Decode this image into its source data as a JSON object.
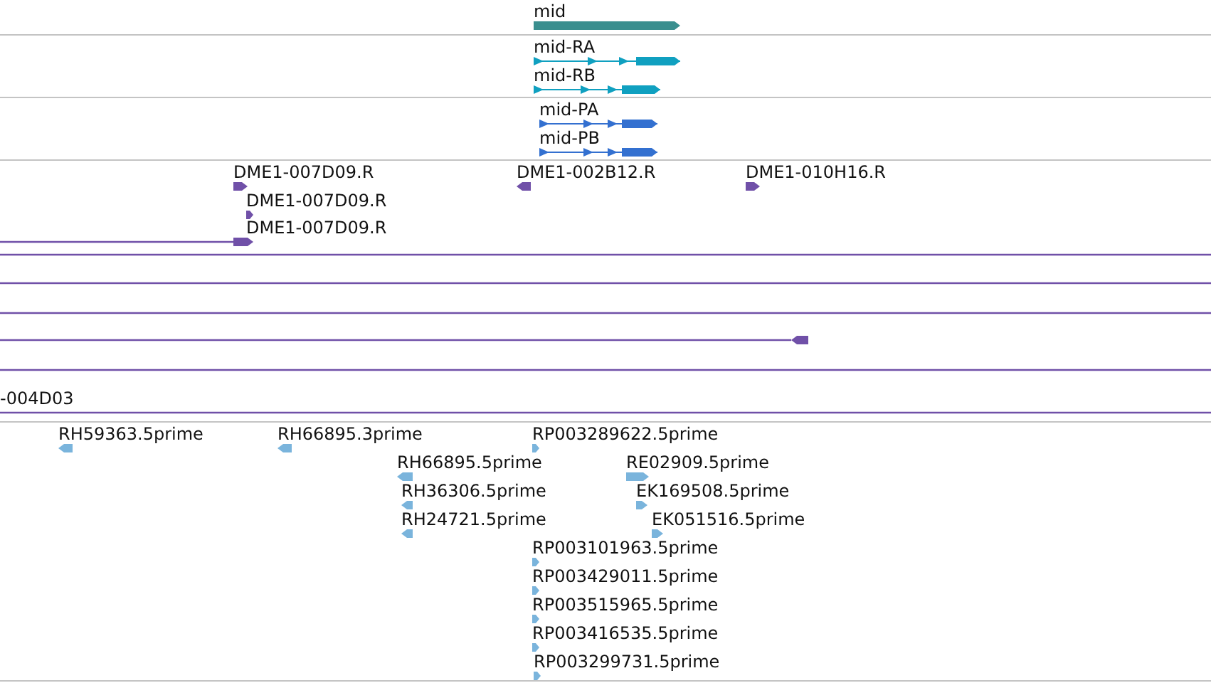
{
  "tracks": [
    {
      "kind": "gene",
      "features": [
        {
          "label": "mid",
          "kind": "arrow",
          "reverse": false
        }
      ]
    },
    {
      "kind": "transcript",
      "features": [
        {
          "label": "mid-RA",
          "kind": "arrow",
          "reverse": false
        },
        {
          "label": "mid-RB",
          "kind": "arrow",
          "reverse": false
        }
      ]
    },
    {
      "kind": "protein",
      "features": [
        {
          "label": "mid-PA",
          "kind": "arrow",
          "reverse": false
        },
        {
          "label": "mid-PB",
          "kind": "arrow",
          "reverse": false
        }
      ]
    },
    {
      "kind": "est",
      "features": [
        {
          "label": "DME1-007D09.R",
          "kind": "arrow",
          "reverse": false
        },
        {
          "label": "DME1-002B12.R",
          "kind": "arrow",
          "reverse": true
        },
        {
          "label": "DME1-010H16.R",
          "kind": "arrow",
          "reverse": false
        },
        {
          "label": "DME1-007D09.R",
          "kind": "arrow",
          "reverse": false
        },
        {
          "label": "DME1-007D09.R",
          "kind": "arrow",
          "reverse": false
        },
        {
          "kind": "line"
        },
        {
          "kind": "line"
        },
        {
          "kind": "line"
        },
        {
          "kind": "arrow",
          "reverse": true
        },
        {
          "kind": "line"
        },
        {
          "label": "-004D03",
          "kind": "line"
        }
      ]
    },
    {
      "kind": "read",
      "features": [
        {
          "label": "RH59363.5prime",
          "kind": "arrow",
          "reverse": true
        },
        {
          "label": "RH66895.3prime",
          "kind": "arrow",
          "reverse": true
        },
        {
          "label": "RP003289622.5prime",
          "kind": "arrow",
          "reverse": false
        },
        {
          "label": "RH66895.5prime",
          "kind": "arrow",
          "reverse": true
        },
        {
          "label": "RE02909.5prime",
          "kind": "arrow",
          "reverse": false
        },
        {
          "label": "RH36306.5prime",
          "kind": "arrow",
          "reverse": true
        },
        {
          "label": "EK169508.5prime",
          "kind": "arrow",
          "reverse": false
        },
        {
          "label": "RH24721.5prime",
          "kind": "arrow",
          "reverse": true
        },
        {
          "label": "EK051516.5prime",
          "kind": "arrow",
          "reverse": false
        },
        {
          "label": "RP003101963.5prime",
          "kind": "arrow",
          "reverse": false
        },
        {
          "label": "RP003429011.5prime",
          "kind": "arrow",
          "reverse": false
        },
        {
          "label": "RP003515965.5prime",
          "kind": "arrow",
          "reverse": false
        },
        {
          "label": "RP003416535.5prime",
          "kind": "arrow",
          "reverse": false
        },
        {
          "label": "RP003299731.5prime",
          "kind": "arrow",
          "reverse": false
        }
      ]
    }
  ]
}
